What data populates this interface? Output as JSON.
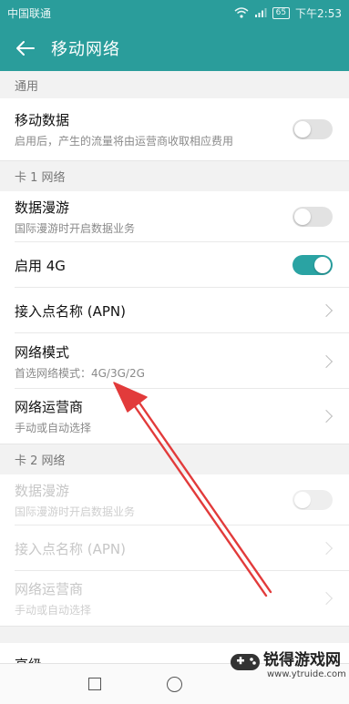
{
  "status": {
    "carrier": "中国联通",
    "battery": "65",
    "time": "下午2:53"
  },
  "header": {
    "title": "移动网络"
  },
  "sections": {
    "general": "通用",
    "sim1": "卡 1 网络",
    "sim2": "卡 2 网络"
  },
  "rows": {
    "mobile_data": {
      "title": "移动数据",
      "subtitle": "启用后，产生的流量将由运营商收取相应费用",
      "on": false
    },
    "sim1_roaming": {
      "title": "数据漫游",
      "subtitle": "国际漫游时开启数据业务",
      "on": false
    },
    "enable_4g": {
      "title": "启用 4G",
      "on": true
    },
    "sim1_apn": {
      "title": "接入点名称 (APN)"
    },
    "network_mode": {
      "title": "网络模式",
      "subtitle": "首选网络模式：4G/3G/2G"
    },
    "sim1_carrier": {
      "title": "网络运营商",
      "subtitle": "手动或自动选择"
    },
    "sim2_roaming": {
      "title": "数据漫游",
      "subtitle": "国际漫游时开启数据业务",
      "on": false
    },
    "sim2_apn": {
      "title": "接入点名称 (APN)"
    },
    "sim2_carrier": {
      "title": "网络运营商",
      "subtitle": "手动或自动选择"
    },
    "advanced": {
      "title": "高级"
    }
  },
  "watermark": {
    "title": "锐得游戏网",
    "url": "www.ytruide.com"
  },
  "colors": {
    "accent": "#2a9d9b",
    "toggle_on": "#2aa3a3",
    "arrow": "#e23b3b"
  }
}
